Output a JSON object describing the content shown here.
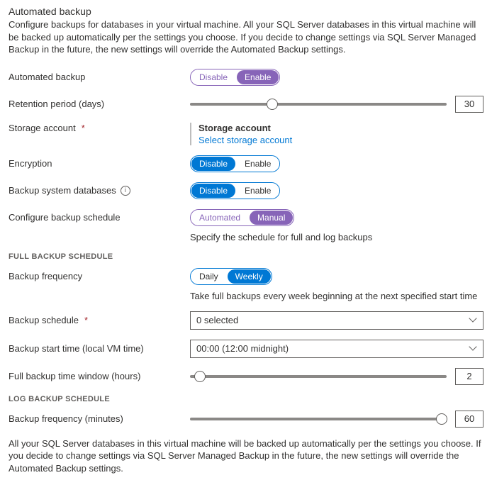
{
  "header": {
    "title": "Automated backup",
    "description": "Configure backups for databases in your virtual machine. All your SQL Server databases in this virtual machine will be backed up automatically per the settings you choose. If you decide to change settings via SQL Server Managed Backup in the future, the new settings will override the Automated Backup settings."
  },
  "fields": {
    "automated_backup": {
      "label": "Automated backup",
      "opt_a": "Disable",
      "opt_b": "Enable"
    },
    "retention": {
      "label": "Retention period (days)",
      "value": "30",
      "thumb_pct": 32
    },
    "storage": {
      "label": "Storage account",
      "heading": "Storage account",
      "link": "Select storage account"
    },
    "encryption": {
      "label": "Encryption",
      "opt_a": "Disable",
      "opt_b": "Enable"
    },
    "system_db": {
      "label": "Backup system databases",
      "opt_a": "Disable",
      "opt_b": "Enable"
    },
    "schedule_mode": {
      "label": "Configure backup schedule",
      "opt_a": "Automated",
      "opt_b": "Manual",
      "help": "Specify the schedule for full and log backups"
    }
  },
  "full_schedule": {
    "heading": "FULL BACKUP SCHEDULE",
    "frequency": {
      "label": "Backup frequency",
      "opt_a": "Daily",
      "opt_b": "Weekly",
      "help": "Take full backups every week beginning at the next specified start time"
    },
    "schedule": {
      "label": "Backup schedule",
      "value": "0 selected"
    },
    "start_time": {
      "label": "Backup start time (local VM time)",
      "value": "00:00 (12:00 midnight)"
    },
    "window": {
      "label": "Full backup time window (hours)",
      "value": "2",
      "thumb_pct": 4
    }
  },
  "log_schedule": {
    "heading": "LOG BACKUP SCHEDULE",
    "frequency": {
      "label": "Backup frequency (minutes)",
      "value": "60",
      "thumb_pct": 98
    }
  },
  "footer": "All your SQL Server databases in this virtual machine will be backed up automatically per the settings you choose. If you decide to change settings via SQL Server Managed Backup in the future, the new settings will override the Automated Backup settings."
}
